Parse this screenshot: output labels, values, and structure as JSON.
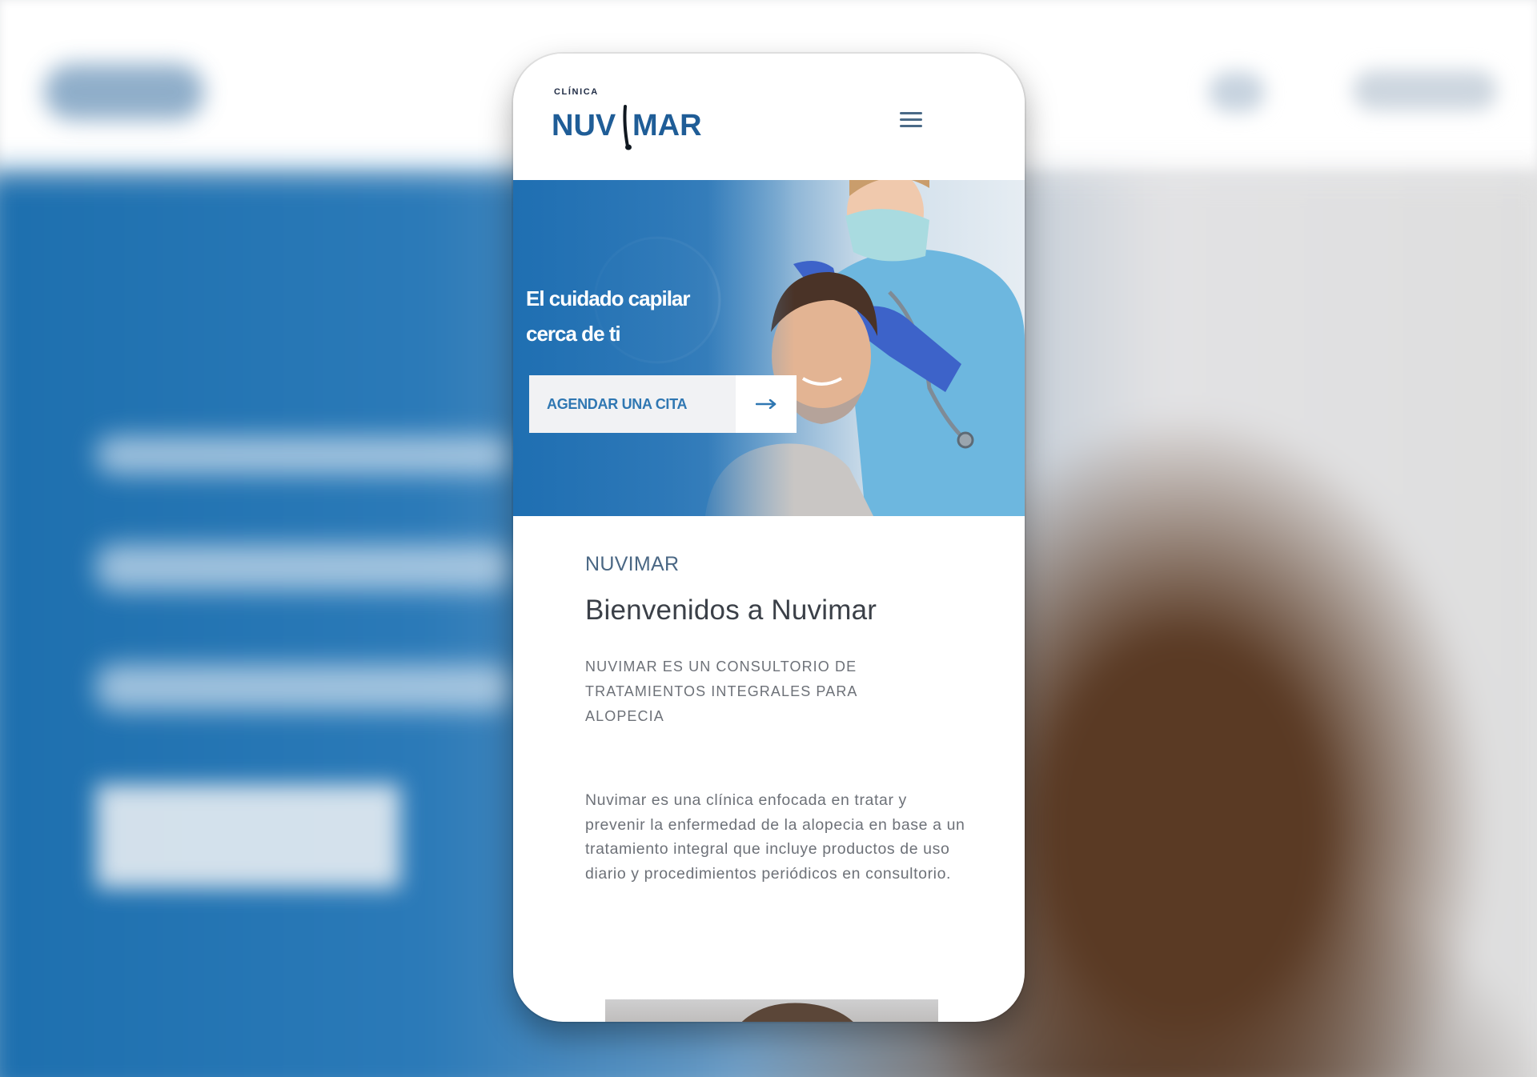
{
  "page": {
    "logo": {
      "small": "CLÍNICA",
      "main_left": "NUV",
      "main_right": "MAR"
    },
    "header": {
      "menu_icon": "hamburger-menu-icon"
    },
    "hero": {
      "title_line1": "El cuidado capilar",
      "title_line2": "cerca de ti",
      "cta_label": "AGENDAR UNA CITA",
      "cta_icon": "arrow-right-icon"
    },
    "intro": {
      "kicker": "NUVIMAR",
      "headline": "Bienvenidos a Nuvimar",
      "tagline": "NUVIMAR ES UN CONSULTORIO DE TRATAMIENTOS INTEGRALES PARA ALOPECIA",
      "body": "Nuvimar es una clínica enfocada en tratar y prevenir la enfermedad de la alopecia en base a un tratamiento integral que incluye productos de uso diario y procedimientos periódicos en consultorio."
    },
    "colors": {
      "brand_blue": "#1f6fb2",
      "logo_navy": "#1f2b44",
      "cta_text": "#2f77b2",
      "body_text": "#6d7178"
    }
  }
}
